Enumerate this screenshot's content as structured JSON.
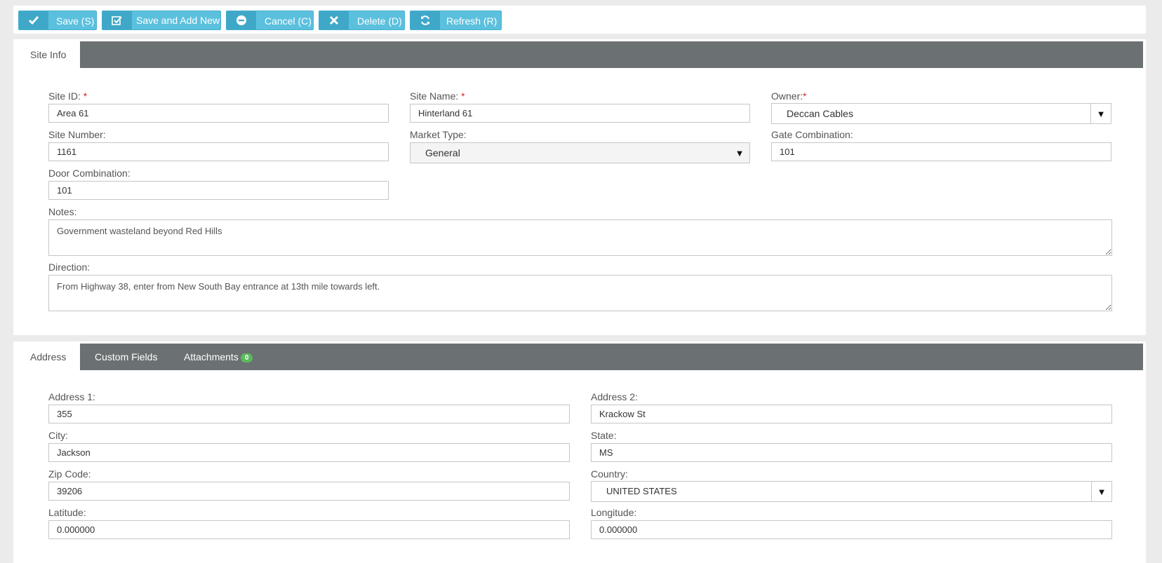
{
  "toolbar": {
    "save": "Save (S)",
    "save_add_new": "Save and Add New",
    "cancel": "Cancel (C)",
    "delete": "Delete (D)",
    "refresh": "Refresh (R)"
  },
  "site_info": {
    "tab_label": "Site Info",
    "site_id": {
      "label": "Site ID:",
      "required": "*",
      "value": "Area 61"
    },
    "site_name": {
      "label": "Site Name:",
      "required": "*",
      "value": "Hinterland 61"
    },
    "owner": {
      "label": "Owner:",
      "required": "*",
      "value": "Deccan Cables"
    },
    "site_number": {
      "label": "Site Number:",
      "value": "1161"
    },
    "market_type": {
      "label": "Market Type:",
      "value": "General"
    },
    "gate_combination": {
      "label": "Gate Combination:",
      "value": "101"
    },
    "door_combination": {
      "label": "Door Combination:",
      "value": "101"
    },
    "notes": {
      "label": "Notes:",
      "value": "Government wasteland beyond Red Hills"
    },
    "direction": {
      "label": "Direction:",
      "value": "From Highway 38, enter from New South Bay entrance at 13th mile towards left."
    }
  },
  "address_panel": {
    "tabs": {
      "address": "Address",
      "custom_fields": "Custom Fields",
      "attachments": "Attachments",
      "attachments_count": "0"
    },
    "address1": {
      "label": "Address 1:",
      "value": "355"
    },
    "address2": {
      "label": "Address 2:",
      "value": "Krackow St"
    },
    "city": {
      "label": "City:",
      "value": "Jackson"
    },
    "state": {
      "label": "State:",
      "value": "MS"
    },
    "zip": {
      "label": "Zip Code:",
      "value": "39206"
    },
    "country": {
      "label": "Country:",
      "value": "UNITED STATES"
    },
    "latitude": {
      "label": "Latitude:",
      "value": "0.000000"
    },
    "longitude": {
      "label": "Longitude:",
      "value": "0.000000"
    }
  },
  "icons": {
    "save": "check-icon",
    "save_add_new": "check-square-icon",
    "cancel": "minus-circle-icon",
    "delete": "times-icon",
    "refresh": "refresh-icon",
    "dropdown": "caret-down-icon"
  },
  "colors": {
    "button": "#5bc0de",
    "tabbar": "#6b7173",
    "required": "#e02222",
    "badge": "#5cb85c"
  }
}
